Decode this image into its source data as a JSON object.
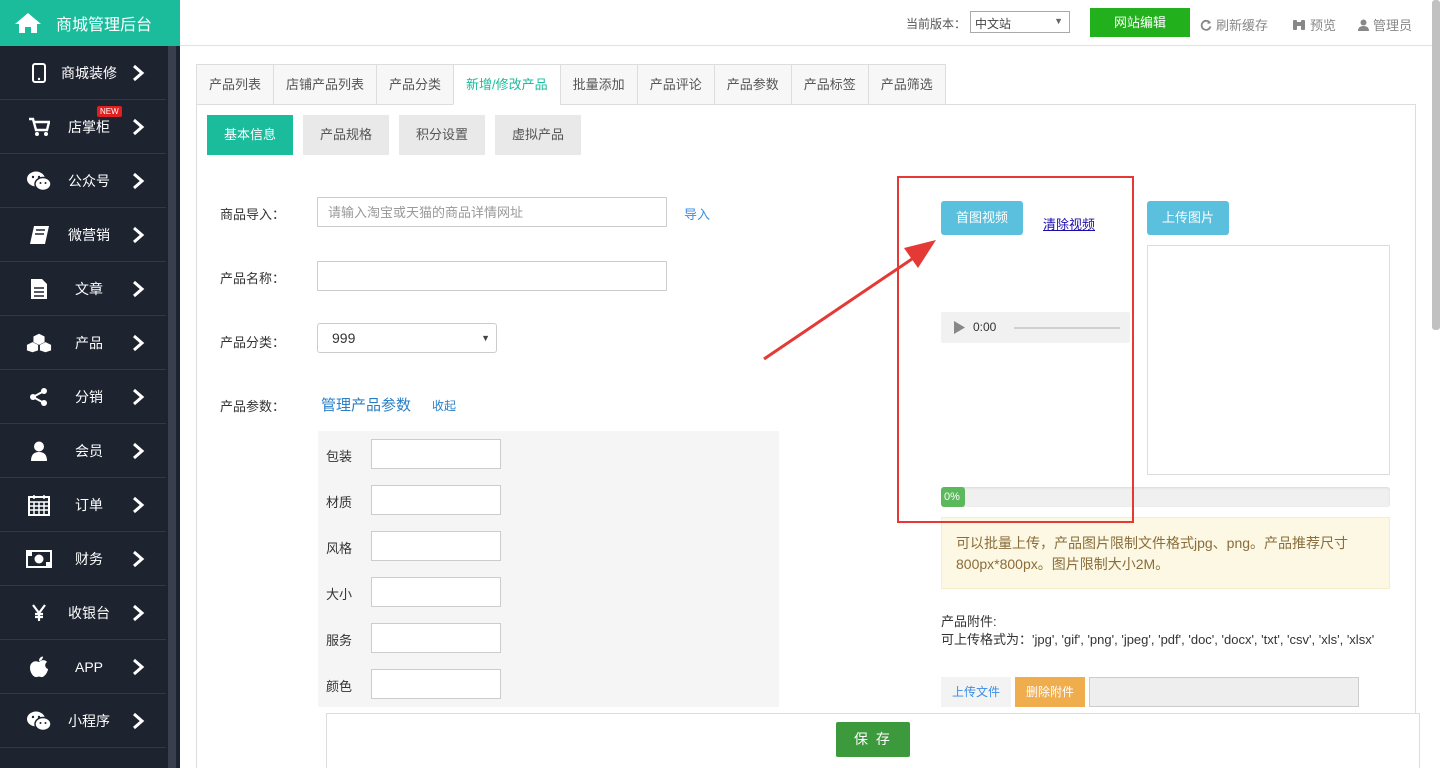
{
  "app": {
    "title": "商城管理后台"
  },
  "sidebar": {
    "items": [
      {
        "label": "商城装修",
        "icon": "mobile-icon"
      },
      {
        "label": "店掌柜",
        "icon": "cart-icon",
        "badge": "NEW"
      },
      {
        "label": "公众号",
        "icon": "wechat-icon"
      },
      {
        "label": "微营销",
        "icon": "book-icon"
      },
      {
        "label": "文章",
        "icon": "document-icon"
      },
      {
        "label": "产品",
        "icon": "cubes-icon"
      },
      {
        "label": "分销",
        "icon": "share-icon"
      },
      {
        "label": "会员",
        "icon": "user-icon"
      },
      {
        "label": "订单",
        "icon": "calendar-icon"
      },
      {
        "label": "财务",
        "icon": "money-icon"
      },
      {
        "label": "收银台",
        "icon": "yen-icon"
      },
      {
        "label": "APP",
        "icon": "apple-icon"
      },
      {
        "label": "小程序",
        "icon": "wechat-icon"
      }
    ]
  },
  "header": {
    "version_label": "当前版本：",
    "version_value": "中文站",
    "site_edit": "网站编辑",
    "refresh": "刷新缓存",
    "preview": "预览",
    "admin": "管理员"
  },
  "main_tabs": [
    "产品列表",
    "店铺产品列表",
    "产品分类",
    "新增/修改产品",
    "批量添加",
    "产品评论",
    "产品参数",
    "产品标签",
    "产品筛选"
  ],
  "sub_tabs": [
    "基本信息",
    "产品规格",
    "积分设置",
    "虚拟产品"
  ],
  "form": {
    "import_label": "商品导入：",
    "import_placeholder": "请输入淘宝或天猫的商品详情网址",
    "import_link": "导入",
    "name_label": "产品名称：",
    "category_label": "产品分类：",
    "category_value": "999",
    "params_label": "产品参数：",
    "manage_params": "管理产品参数",
    "collapse": "收起",
    "params": [
      "包装",
      "材质",
      "风格",
      "大小",
      "服务",
      "颜色"
    ]
  },
  "upload": {
    "video_button": "首图视频",
    "clear_video": "清除视频",
    "audio_time": "0:00",
    "image_button": "上传图片",
    "progress_text": "0%",
    "progress_value": 0,
    "tip": "可以批量上传，产品图片限制文件格式jpg、png。产品推荐尺寸800px*800px。图片限制大小2M。",
    "attach_title": "产品附件:",
    "attach_formats": "可上传格式为：'jpg', 'gif', 'png', 'jpeg', 'pdf', 'doc', 'docx', 'txt', 'csv', 'xls', 'xlsx'",
    "upload_file": "上传文件",
    "delete_attach": "删除附件"
  },
  "save_button": "保 存",
  "colors": {
    "brand": "#1abc9c",
    "sidebar_bg": "#1e2330",
    "site_edit": "#22b11c",
    "info_btn": "#5bc0de",
    "save": "#3c9a3c",
    "highlight": "#e53935"
  }
}
